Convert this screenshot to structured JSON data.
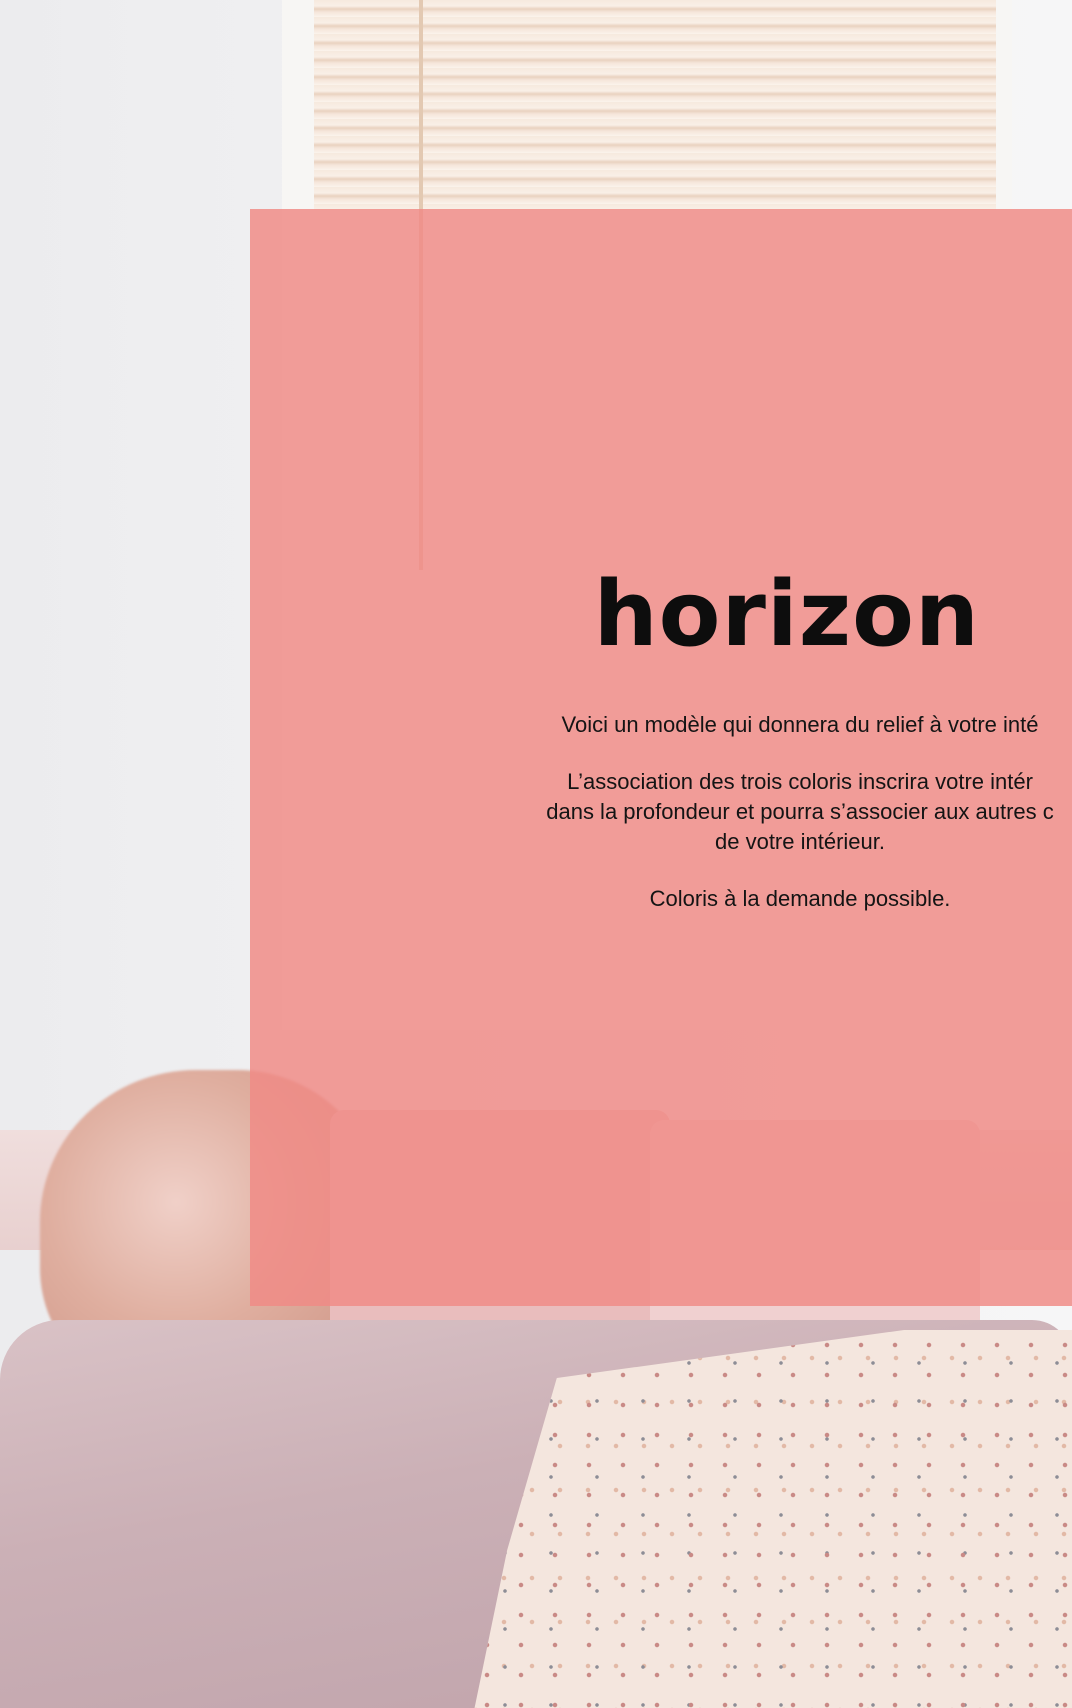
{
  "page": {
    "title": "horizon",
    "paragraphs": {
      "p1": "Voici un modèle qui donnera du relief à votre inté",
      "p2_line1": "L’association des trois coloris inscrira votre intér",
      "p2_line2": "dans la profondeur et pourra s’associer aux autres c",
      "p2_line3": "de votre intérieur.",
      "p3": "Coloris à la demande possible."
    }
  },
  "colors": {
    "overlay": "#f08a86",
    "title_text": "#0d0d0d",
    "body_text": "#141414"
  }
}
